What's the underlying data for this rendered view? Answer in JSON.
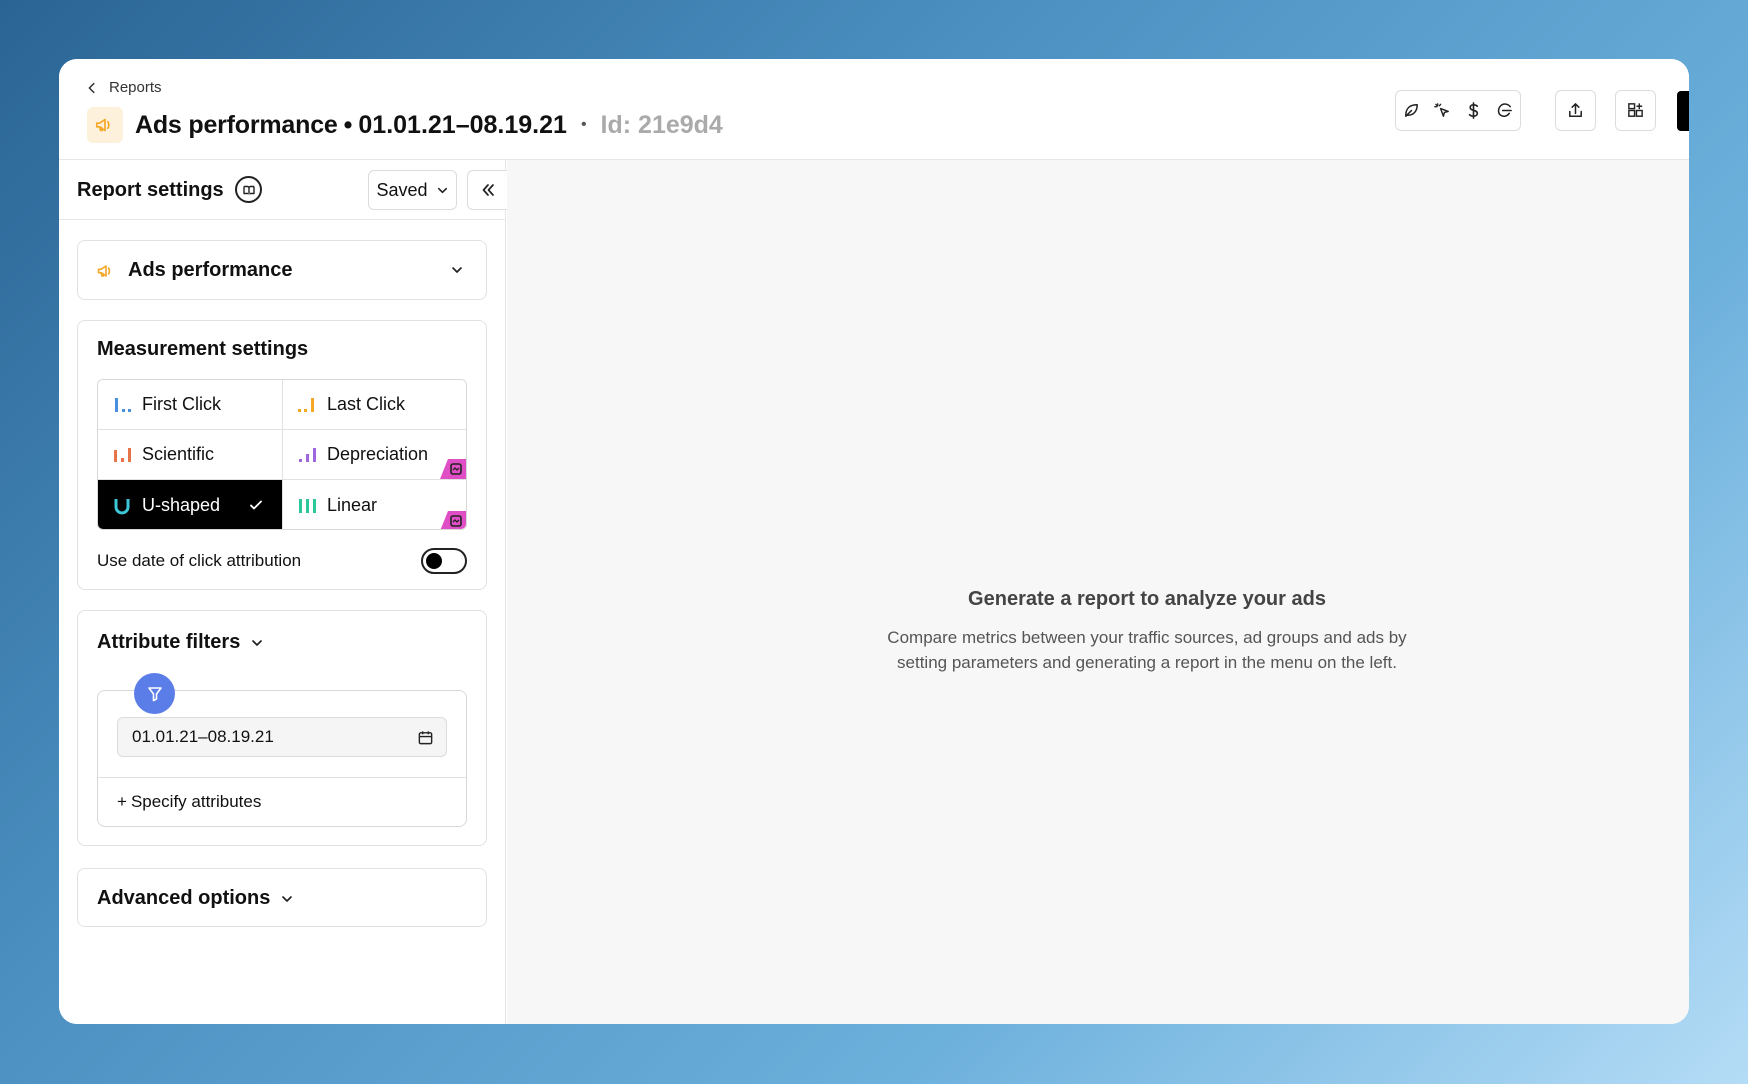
{
  "header": {
    "breadcrumb": "Reports",
    "title": "Ads performance",
    "title_dot": "•",
    "date_range": "01.01.21–08.19.21",
    "separator": "•",
    "report_id": "Id: 21e9d4"
  },
  "toolbar": {
    "tools": [
      "leaf-icon",
      "cursor-click-icon",
      "dollar-icon",
      "tag-icon"
    ],
    "share_icon": "share-icon",
    "layout_icon": "layout-add-icon"
  },
  "sidebar": {
    "title": "Report settings",
    "saved_label": "Saved",
    "report_type": "Ads performance",
    "measurement": {
      "title": "Measurement settings",
      "models": [
        {
          "label": "First Click",
          "icon": "first-click-icon",
          "color": "#4a90e2",
          "selected": false,
          "premium": false
        },
        {
          "label": "Last Click",
          "icon": "last-click-icon",
          "color": "#f5a623",
          "selected": false,
          "premium": false
        },
        {
          "label": "Scientific",
          "icon": "scientific-icon",
          "color": "#e8734a",
          "selected": false,
          "premium": false
        },
        {
          "label": "Depreciation",
          "icon": "depreciation-icon",
          "color": "#a066e0",
          "selected": false,
          "premium": true
        },
        {
          "label": "U-shaped",
          "icon": "u-shaped-icon",
          "color": "#3dc7d6",
          "selected": true,
          "premium": false
        },
        {
          "label": "Linear",
          "icon": "linear-icon",
          "color": "#2dc89a",
          "selected": false,
          "premium": true
        }
      ],
      "toggle_label": "Use date of click attribution",
      "toggle_on": false
    },
    "attribute_filters": {
      "title": "Attribute filters",
      "date_value": "01.01.21–08.19.21",
      "specify_label": "Specify attributes",
      "specify_prefix": "+"
    },
    "advanced_options": {
      "title": "Advanced options"
    }
  },
  "main": {
    "empty_title": "Generate a report to analyze your ads",
    "empty_description": "Compare metrics between your traffic sources, ad groups and ads by setting parameters and generating a report in the menu on the left."
  },
  "colors": {
    "accent_blue": "#5b7de8",
    "premium_badge": "#e04ec6",
    "title_icon_bg": "#fdf1dc",
    "title_icon": "#f5a623"
  }
}
